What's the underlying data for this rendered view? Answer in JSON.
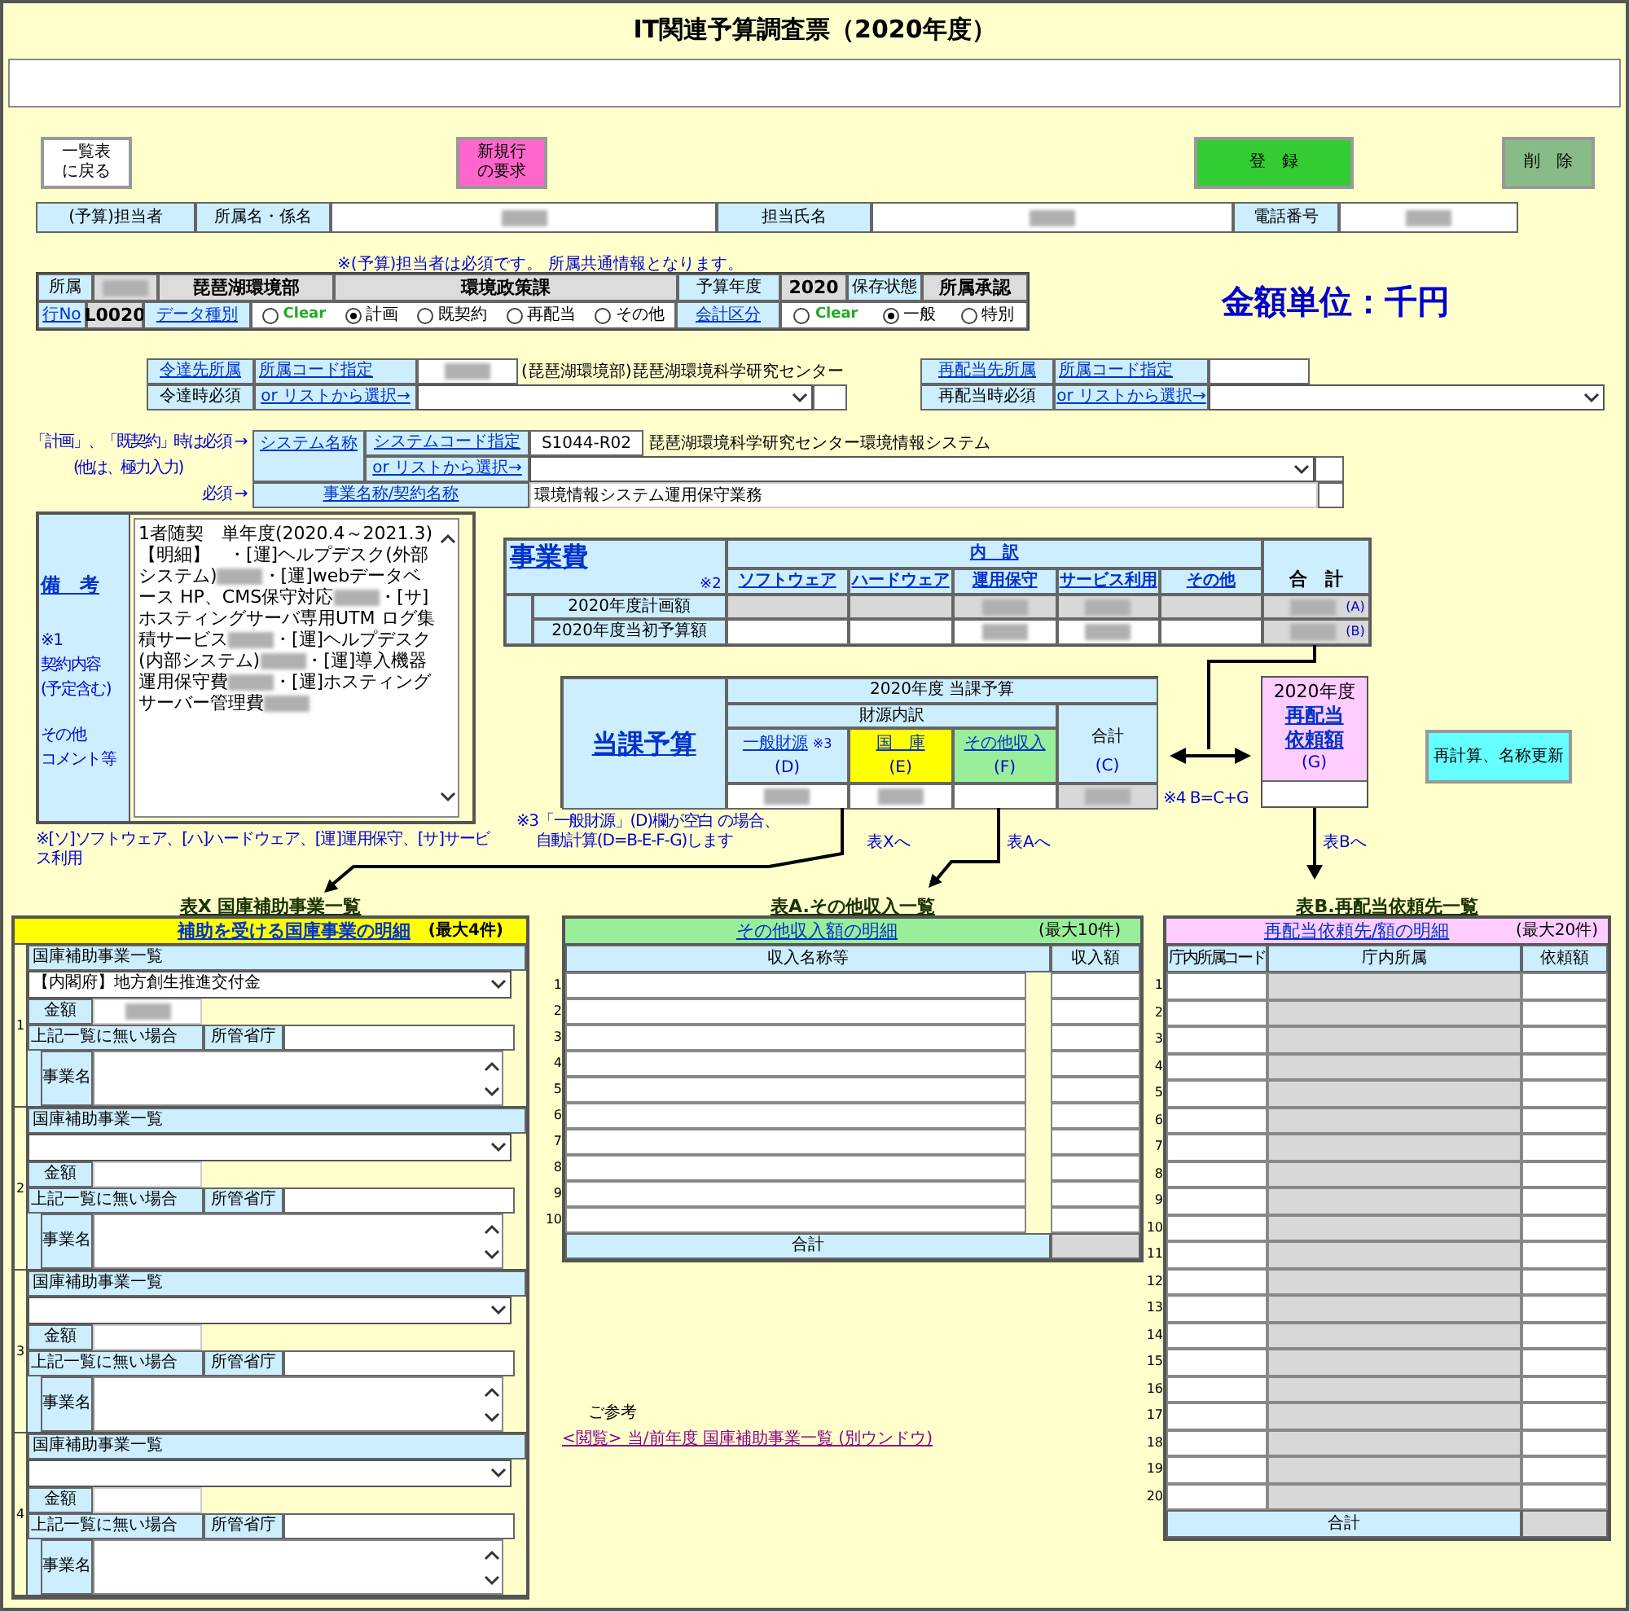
{
  "title": "IT関連予算調査票（2020年度）",
  "buttons": [
    {
      "kind": "back",
      "lines": [
        "一覧表",
        "に戻る"
      ]
    },
    {
      "kind": "new_row",
      "lines": [
        "新規行",
        "の要求"
      ]
    },
    {
      "kind": "register",
      "lines": [
        "登　録"
      ]
    },
    {
      "kind": "delete",
      "lines": [
        "削　除"
      ]
    }
  ],
  "staff": [
    {
      "kind": "label",
      "text": "(予算)担当者"
    },
    {
      "kind": "label",
      "text": "所属名・係名"
    },
    {
      "kind": "value",
      "redacted": true
    },
    {
      "kind": "label",
      "text": "担当氏名"
    },
    {
      "kind": "value",
      "redacted": true
    },
    {
      "kind": "label",
      "text": "電話番号"
    },
    {
      "kind": "value",
      "redacted": true
    }
  ],
  "staff_note": "※(予算)担当者は必須です。 所属共通情報となります。",
  "affiliation": {
    "row1": [
      {
        "kind": "label",
        "text": "所属"
      },
      {
        "kind": "value",
        "redacted": true
      },
      {
        "kind": "value",
        "text": "琵琶湖環境部"
      },
      {
        "kind": "value",
        "text": "環境政策課"
      },
      {
        "kind": "label",
        "text": "予算年度"
      },
      {
        "kind": "value",
        "text": "2020"
      },
      {
        "kind": "label",
        "text": "保存状態"
      },
      {
        "kind": "value",
        "text": "所属承認"
      }
    ],
    "row2": [
      {
        "kind": "link",
        "text": "行No"
      },
      {
        "kind": "value",
        "text": "L0020"
      },
      {
        "kind": "link",
        "text": "データ種別"
      },
      {
        "kind": "radios",
        "options": [
          {
            "kind": "clear",
            "label": "Clear",
            "selected": false
          },
          {
            "kind": "choice",
            "label": "計画",
            "selected": true
          },
          {
            "kind": "choice",
            "label": "既契約",
            "selected": false
          },
          {
            "kind": "choice",
            "label": "再配当",
            "selected": false
          },
          {
            "kind": "choice",
            "label": "その他",
            "selected": false
          }
        ]
      },
      {
        "kind": "link",
        "text": "会計区分"
      },
      {
        "kind": "radios",
        "options": [
          {
            "kind": "clear",
            "label": "Clear",
            "selected": false
          },
          {
            "kind": "choice",
            "label": "一般",
            "selected": true
          },
          {
            "kind": "choice",
            "label": "特別",
            "selected": false
          }
        ]
      }
    ]
  },
  "unit_label": "金額単位：千円",
  "distribution": [
    {
      "link_label": "令達先所属",
      "required_label": "令達時必須",
      "code_link": "所属コード指定",
      "list_link": "or リストから選択→",
      "code_redacted": true,
      "name": "(琵琶湖環境部)琵琶湖環境科学研究センター"
    },
    {
      "link_label": "再配当先所属",
      "required_label": "再配当時必須",
      "code_link": "所属コード指定",
      "list_link": "or リストから選択→",
      "code_redacted": false
    }
  ],
  "system": {
    "notes": [
      "「計画」、「既契約」時は必須 →",
      "(他は、極力入力)",
      "必須 →"
    ],
    "name_link": "システム名称",
    "code_link": "システムコード指定",
    "list_link": "or リストから選択→",
    "code": "S1044-R02",
    "name": "琵琶湖環境科学研究センター環境情報システム",
    "project_link": "事業名称/契約名称",
    "project_name": "環境情報システム運用保守業務"
  },
  "remarks": {
    "link": "備　考",
    "note_groups": [
      [
        "※1",
        "契約内容",
        "(予定含む)"
      ],
      [
        "その他",
        "コメント等"
      ]
    ],
    "segments": [
      {
        "text": "1者随契　単年度(2020.4～2021.3)【明細】　・[運]ヘルプデスク(外部システム)"
      },
      {
        "redacted": true
      },
      {
        "text": "・[運]webデータベース HP、CMS保守対応"
      },
      {
        "redacted": true
      },
      {
        "text": "・[サ]ホスティングサーバ専用UTM ログ集積サービス"
      },
      {
        "redacted": true
      },
      {
        "text": "・[運]ヘルプデスク(内部システム)"
      },
      {
        "redacted": true
      },
      {
        "text": "・[運]導入機器運用保守費"
      },
      {
        "redacted": true
      },
      {
        "text": "・[運]ホスティングサーバー管理費"
      },
      {
        "redacted": true
      }
    ]
  },
  "remarks_footnote": "※[ソ]ソフトウェア、[ハ]ハードウェア、[運]運用保守、[サ]サービス利用",
  "project_cost": {
    "title": "事業費",
    "note_mark": "※2",
    "breakdown": "内　訳",
    "columns": [
      "ソフトウェア",
      "ハードウェア",
      "運用保守",
      "サービス利用",
      "その他"
    ],
    "total": "合　計",
    "rows": [
      {
        "label": "2020年度計画額",
        "cells": [
          {
            "editable": false,
            "redacted": false
          },
          {
            "editable": false,
            "redacted": false
          },
          {
            "editable": false,
            "redacted": true
          },
          {
            "editable": false,
            "redacted": true
          },
          {
            "editable": false,
            "redacted": false
          }
        ],
        "total": {
          "redacted": true,
          "mark": "(A)"
        }
      },
      {
        "label": "2020年度当初予算額",
        "cells": [
          {
            "editable": true,
            "redacted": false
          },
          {
            "editable": true,
            "redacted": false
          },
          {
            "editable": true,
            "redacted": true
          },
          {
            "editable": true,
            "redacted": true
          },
          {
            "editable": true,
            "redacted": false
          }
        ],
        "total": {
          "redacted": true,
          "mark": "(B)"
        }
      }
    ]
  },
  "dept_budget": {
    "title": "当課予算",
    "heading": "2020年度 当課予算",
    "source_heading": "財源内訳",
    "columns": [
      {
        "label": "一般財源",
        "note": "※3",
        "mark": "(D)",
        "color": "#cceeff",
        "redacted": true
      },
      {
        "label": "国　庫",
        "mark": "(E)",
        "color": "#ffff00",
        "redacted": true
      },
      {
        "label": "その他収入",
        "mark": "(F)",
        "color": "#99ee99",
        "redacted": false
      }
    ],
    "total": {
      "label": "合計",
      "mark": "(C)",
      "redacted": true
    }
  },
  "reallocation": {
    "year": "2020年度",
    "link_lines": [
      "再配当",
      "依頼額"
    ],
    "mark": "(G)"
  },
  "recalc_button": "再計算、名称更新",
  "budget_note": [
    "※3「一般財源」(D)欄が空白 の場合、",
    "自動計算(D=B-E-F-G)します"
  ],
  "arrow_labels": {
    "equation": "※4 B=C+G",
    "to_x": "表Xへ",
    "to_a": "表Aへ",
    "to_b": "表Bへ"
  },
  "table_x": {
    "title": "表X 国庫補助事業一覧",
    "header_link": "補助を受ける国庫事業の明細",
    "max": "(最大4件)",
    "entries": [
      {
        "no": "1",
        "list_label": "国庫補助事業一覧",
        "selected_value": "【内閣府】地方創生推進交付金",
        "amount_label": "金額",
        "amount_redacted": true,
        "other_label": "上記一覧に無い場合",
        "ministry_label": "所管省庁",
        "project_label": "事業名"
      },
      {
        "no": "2",
        "list_label": "国庫補助事業一覧",
        "amount_label": "金額",
        "amount_redacted": false,
        "other_label": "上記一覧に無い場合",
        "ministry_label": "所管省庁",
        "project_label": "事業名"
      },
      {
        "no": "3",
        "list_label": "国庫補助事業一覧",
        "amount_label": "金額",
        "amount_redacted": false,
        "other_label": "上記一覧に無い場合",
        "ministry_label": "所管省庁",
        "project_label": "事業名"
      },
      {
        "no": "4",
        "list_label": "国庫補助事業一覧",
        "amount_label": "金額",
        "amount_redacted": false,
        "other_label": "上記一覧に無い場合",
        "ministry_label": "所管省庁",
        "project_label": "事業名"
      }
    ]
  },
  "table_a": {
    "title": "表A.その他収入一覧",
    "header_link": "その他収入額の明細",
    "max": "(最大10件)",
    "columns": [
      "収入名称等",
      "収入額"
    ],
    "rows": [
      "1",
      "2",
      "3",
      "4",
      "5",
      "6",
      "7",
      "8",
      "9",
      "10"
    ],
    "total": "合計"
  },
  "reference": {
    "label": "ご参考",
    "link": "<閲覧> 当/前年度 国庫補助事業一覧 (別ウンドウ)"
  },
  "table_b": {
    "title": "表B.再配当依頼先一覧",
    "header_link": "再配当依頼先/額の明細",
    "max": "(最大20件)",
    "columns": [
      "庁内所属コード",
      "庁内所属",
      "依頼額"
    ],
    "rows": [
      "1",
      "2",
      "3",
      "4",
      "5",
      "6",
      "7",
      "8",
      "9",
      "10",
      "11",
      "12",
      "13",
      "14",
      "15",
      "16",
      "17",
      "18",
      "19",
      "20"
    ],
    "total": "合計"
  }
}
